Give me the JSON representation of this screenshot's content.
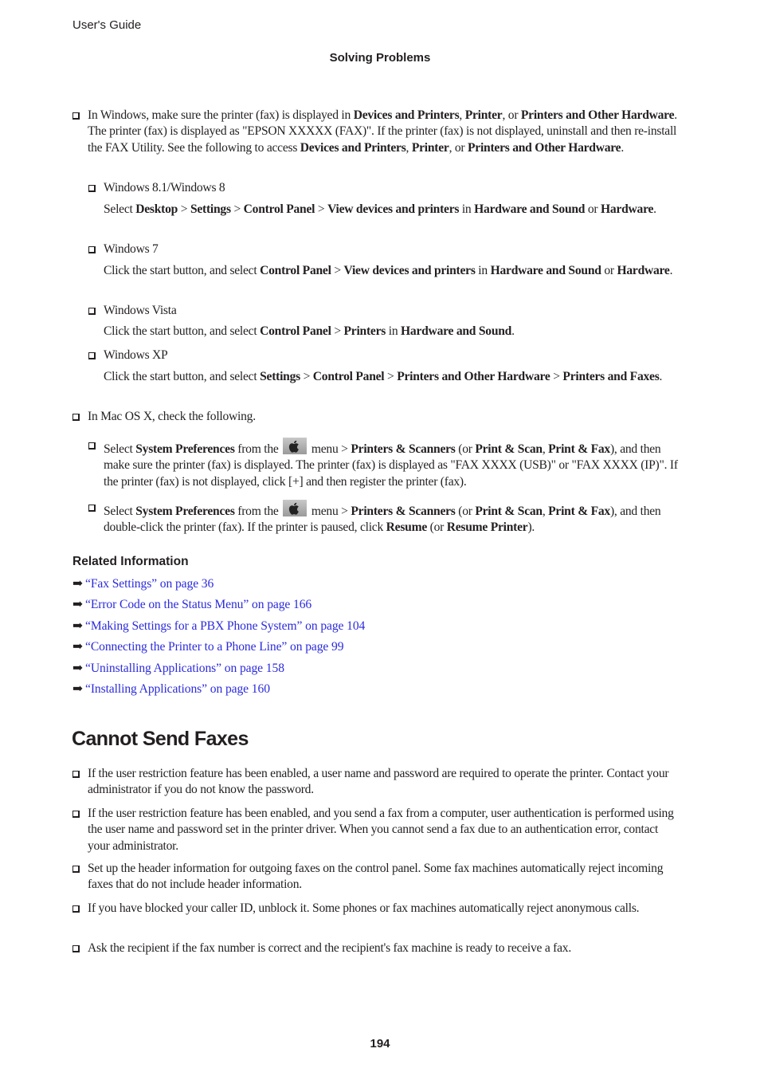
{
  "header": {
    "running_title": "User's Guide",
    "section": "Solving Problems"
  },
  "windows_item": {
    "text_html": "In Windows, make sure the printer (fax) is displayed in <b>Devices and Printers</b>, <b>Printer</b>, or <b>Printers and Other Hardware</b>. The printer (fax) is displayed as \"EPSON XXXXX (FAX)\". If the printer (fax) is not displayed, uninstall and then re-install the FAX Utility. See the following to access <b>Devices and Printers</b>, <b>Printer</b>, or <b>Printers and Other Hardware</b>.",
    "sub_items": [
      {
        "os": "Windows 8.1/Windows 8",
        "instruction_html": "Select <b>Desktop</b> &gt; <b>Settings</b> &gt; <b>Control Panel</b> &gt; <b>View devices and printers</b> in <b>Hardware and Sound</b> or <b>Hardware</b>."
      },
      {
        "os": "Windows 7",
        "instruction_html": "Click the start button, and select <b>Control Panel</b> &gt; <b>View devices and printers</b> in <b>Hardware and Sound</b> or <b>Hardware</b>."
      },
      {
        "os": "Windows Vista",
        "instruction_html": "Click the start button, and select <b>Control Panel</b> &gt; <b>Printers</b> in <b>Hardware and Sound</b>."
      },
      {
        "os": "Windows XP",
        "instruction_html": "Click the start button, and select <b>Settings</b> &gt; <b>Control Panel</b> &gt; <b>Printers and Other Hardware</b> &gt; <b>Printers and Faxes</b>."
      }
    ]
  },
  "mac_item": {
    "text": "In Mac OS X, check the following.",
    "sub_items": [
      {
        "before_icon_html": "Select <b>System Preferences</b> from the",
        "after_icon_html": "menu &gt; <b>Printers &amp; Scanners</b> (or <b>Print &amp; Scan</b>, <b>Print &amp; Fax</b>), and then make sure the printer (fax) is displayed. The printer (fax) is displayed as \"FAX XXXX (USB)\" or \"FAX XXXX (IP)\". If the printer (fax) is not displayed, click [+] and then register the printer (fax).",
        "icon": "apple-menu-icon"
      },
      {
        "before_icon_html": "Select <b>System Preferences</b> from the",
        "after_icon_html": "menu &gt; <b>Printers &amp; Scanners</b> (or <b>Print &amp; Scan</b>, <b>Print &amp; Fax</b>), and then double-click the printer (fax). If the printer is paused, click <b>Resume</b> (or <b>Resume Printer</b>).",
        "icon": "apple-menu-icon"
      }
    ]
  },
  "related": {
    "title": "Related Information",
    "arrow_icon": "right-arrow-icon",
    "links": [
      "“Fax Settings” on page 36",
      "“Error Code on the Status Menu” on page 166",
      "“Making Settings for a PBX Phone System” on page 104",
      "“Connecting the Printer to a Phone Line” on page 99",
      "“Uninstalling Applications” on page 158",
      "“Installing Applications” on page 160"
    ],
    "link_color": "#2b2bdc"
  },
  "cannot_send": {
    "heading": "Cannot Send Faxes",
    "items": [
      "If the user restriction feature has been enabled, a user name and password are required to operate the printer. Contact your administrator if you do not know the password.",
      "If the user restriction feature has been enabled, and you send a fax from a computer, user authentication is performed using the user name and password set in the printer driver. When you cannot send a fax due to an authentication error, contact your administrator.",
      "Set up the header information for outgoing faxes on the control panel. Some fax machines automatically reject incoming faxes that do not include header information.",
      "If you have blocked your caller ID, unblock it. Some phones or fax machines automatically reject anonymous calls.",
      "Ask the recipient if the fax number is correct and the recipient's fax machine is ready to receive a fax."
    ]
  },
  "footer": {
    "page_number": "194"
  }
}
